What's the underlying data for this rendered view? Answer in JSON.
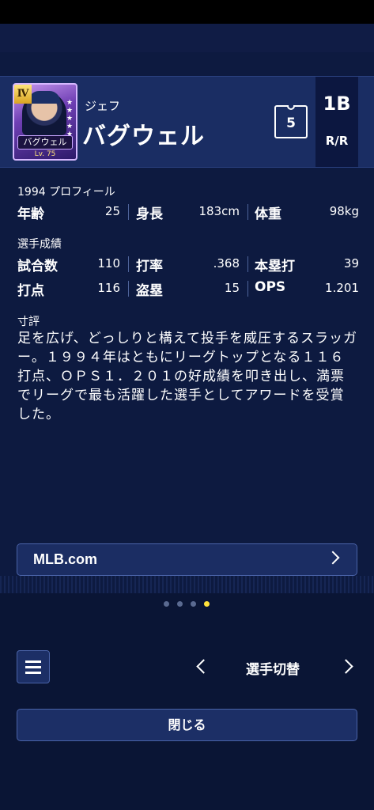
{
  "player": {
    "card_rank": "Ⅳ",
    "card_name": "バグウェル",
    "card_level": "Lv. 75",
    "first_name": "ジェフ",
    "last_name": "バグウェル",
    "number": "5",
    "position": "1B",
    "bats_throws": "R/R"
  },
  "profile": {
    "heading": "1994 プロフィール",
    "age_label": "年齢",
    "age": "25",
    "height_label": "身長",
    "height": "183cm",
    "weight_label": "体重",
    "weight": "98kg"
  },
  "stats": {
    "heading": "選手成績",
    "games_label": "試合数",
    "games": "110",
    "avg_label": "打率",
    "avg": ".368",
    "hr_label": "本塁打",
    "hr": "39",
    "rbi_label": "打点",
    "rbi": "116",
    "sb_label": "盗塁",
    "sb": "15",
    "ops_label": "OPS",
    "ops": "1.201"
  },
  "review": {
    "heading": "寸評",
    "text": "足を広げ、どっしりと構えて投手を威圧するスラッガー。１９９４年はともにリーグトップとなる１１６打点、ＯＰＳ１．２０１の好成績を叩き出し、満票でリーグで最も活躍した選手としてアワードを受賞した。"
  },
  "link": {
    "label": "MLB.com"
  },
  "pager": {
    "count": 4,
    "active": 3
  },
  "footer": {
    "switch_label": "選手切替",
    "close_label": "閉じる"
  },
  "colors": {
    "accent_dot": "#ffe23b",
    "background": "#0d1a40"
  }
}
